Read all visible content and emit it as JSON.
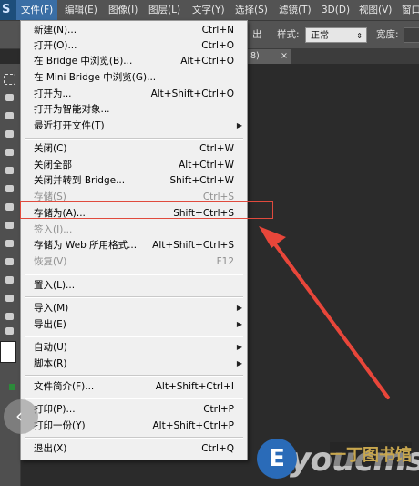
{
  "menubar": {
    "logo": "S",
    "items": [
      "文件(F)",
      "编辑(E)",
      "图像(I)",
      "图层(L)",
      "文字(Y)",
      "选择(S)",
      "滤镜(T)",
      "3D(D)",
      "视图(V)",
      "窗口"
    ]
  },
  "optbar": {
    "partial_text": "出",
    "style_label": "样式:",
    "style_value": "正常",
    "width_label": "宽度:"
  },
  "doc_tab": {
    "name": "8)",
    "close": "×"
  },
  "file_menu": {
    "items": [
      {
        "label": "新建(N)...",
        "shortcut": "Ctrl+N"
      },
      {
        "label": "打开(O)...",
        "shortcut": "Ctrl+O"
      },
      {
        "label": "在 Bridge 中浏览(B)...",
        "shortcut": "Alt+Ctrl+O"
      },
      {
        "label": "在 Mini Bridge 中浏览(G)...",
        "shortcut": ""
      },
      {
        "label": "打开为...",
        "shortcut": "Alt+Shift+Ctrl+O"
      },
      {
        "label": "打开为智能对象...",
        "shortcut": ""
      },
      {
        "label": "最近打开文件(T)",
        "shortcut": ""
      },
      {
        "label": "关闭(C)",
        "shortcut": "Ctrl+W"
      },
      {
        "label": "关闭全部",
        "shortcut": "Alt+Ctrl+W"
      },
      {
        "label": "关闭并转到 Bridge...",
        "shortcut": "Shift+Ctrl+W"
      },
      {
        "label": "存储(S)",
        "shortcut": "Ctrl+S"
      },
      {
        "label": "存储为(A)...",
        "shortcut": "Shift+Ctrl+S"
      },
      {
        "label": "签入(I)...",
        "shortcut": ""
      },
      {
        "label": "存储为 Web 所用格式...",
        "shortcut": "Alt+Shift+Ctrl+S"
      },
      {
        "label": "恢复(V)",
        "shortcut": "F12"
      },
      {
        "label": "置入(L)...",
        "shortcut": ""
      },
      {
        "label": "导入(M)",
        "shortcut": ""
      },
      {
        "label": "导出(E)",
        "shortcut": ""
      },
      {
        "label": "自动(U)",
        "shortcut": ""
      },
      {
        "label": "脚本(R)",
        "shortcut": ""
      },
      {
        "label": "文件简介(F)...",
        "shortcut": "Alt+Shift+Ctrl+I"
      },
      {
        "label": "打印(P)...",
        "shortcut": "Ctrl+P"
      },
      {
        "label": "打印一份(Y)",
        "shortcut": "Alt+Shift+Ctrl+P"
      },
      {
        "label": "退出(X)",
        "shortcut": "Ctrl+Q"
      }
    ],
    "submenu_arrow": "▶"
  },
  "watermark": {
    "letter": "E",
    "text": "youcms",
    "cn": "一丁图书馆"
  },
  "colors": {
    "highlight": "#e04a3d",
    "arrow": "#e8463a",
    "menubar": "#535353",
    "active_menu": "#3a6ea5"
  }
}
